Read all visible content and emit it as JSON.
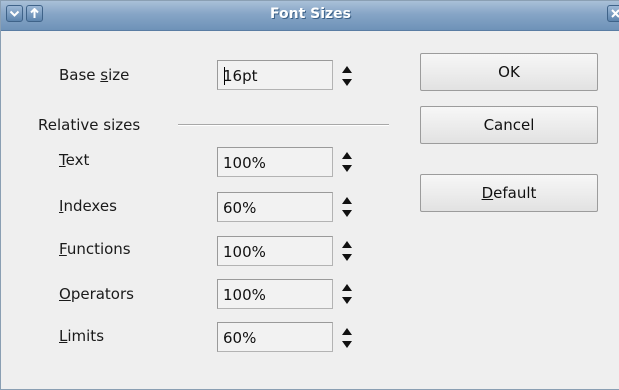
{
  "title": "Font Sizes",
  "titlebar_buttons": {
    "menu_icon": "chevron-down-icon",
    "shade_icon": "arrow-up-icon",
    "close_icon": "close-icon"
  },
  "base_size": {
    "label_pre": "Base ",
    "label_mn": "s",
    "label_post": "ize",
    "value": "16pt"
  },
  "relative_sizes_label": "Relative sizes",
  "rows": [
    {
      "mn": "T",
      "rest": "ext",
      "value": "100%"
    },
    {
      "mn": "I",
      "rest": "ndexes",
      "value": "60%"
    },
    {
      "mn": "F",
      "rest": "unctions",
      "value": "100%"
    },
    {
      "mn": "O",
      "rest": "perators",
      "value": "100%"
    },
    {
      "mn": "L",
      "rest": "imits",
      "value": "60%"
    }
  ],
  "buttons": {
    "ok": "OK",
    "cancel": "Cancel",
    "default_mn": "D",
    "default_rest": "efault"
  },
  "colors": {
    "titlebar": "#7f9fc2",
    "dialog_bg": "#efefef"
  }
}
